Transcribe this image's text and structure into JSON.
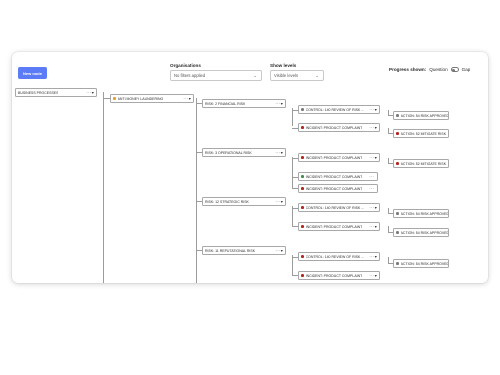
{
  "toolbar": {
    "new_node_label": "New node",
    "organisations_label": "Organisations",
    "organisations_value": "No filters applied",
    "show_levels_label": "Show levels",
    "show_levels_value": "Visible levels",
    "progress_label": "Progress shown:",
    "progress_left": "Question",
    "progress_right": "Gap"
  },
  "colors": {
    "accent": "#5b7cf6",
    "red_dot": "#b3261e",
    "grey_dot": "#7d7d7d",
    "green_dot": "#3a8f4b",
    "orange_dot": "#e0a030"
  },
  "icons": {
    "more": "ellipsis-icon",
    "expand": "triangle-down-icon"
  },
  "tree": {
    "root": "BUSINESS PROCESSES",
    "level1": "ANTI MONEY LAUNDERING",
    "risks": [
      "RISK: 2 FINANCIAL RISK",
      "RISK: 3 OPERATIONAL RISK",
      "RISK: 12 STRATEGIC RISK",
      "RISK: 11 REPUTATIONAL RISK"
    ],
    "controls": {
      "c1": "CONTROL: 140 REVIEW OF RISK ...",
      "i1": "INCIDENT: PRODUCT COMPLAINT",
      "i2": "INCIDENT: PRODUCT COMPLAINT",
      "i3": "INCIDENT: PRODUCT COMPLAINT",
      "i4": "INCIDENT: PRODUCT COMPLAINT",
      "c2": "CONTROL: 140 REVIEW OF RISK ...",
      "i5": "INCIDENT: PRODUCT COMPLAINT",
      "c3": "CONTROL: 140 REVIEW OF RISK ...",
      "i6": "INCIDENT: PRODUCT COMPLAINT"
    },
    "actions": {
      "a1": "ACTION: 54 RISK APPROVED",
      "a2": "ACTION: 52 MITIGATE RISK",
      "a3": "ACTION: 52 MITIGATE RISK",
      "a4": "ACTION: 54 RISK APPROVED",
      "a5": "ACTION: 54 RISK APPROVED",
      "a6": "ACTION: 54 RISK APPROVED"
    },
    "more_label": "···",
    "expand_label": "▼"
  }
}
